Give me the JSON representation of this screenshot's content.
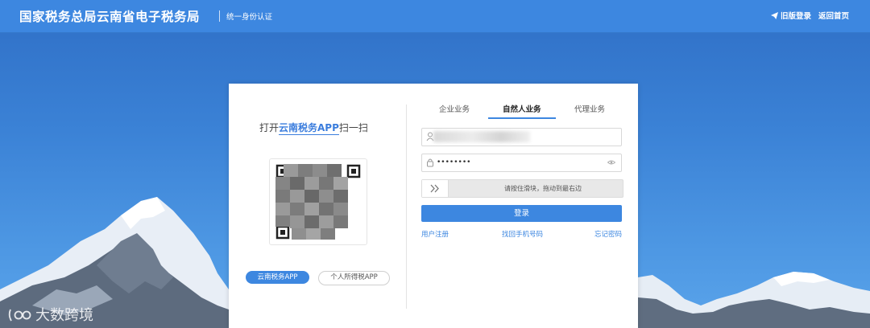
{
  "header": {
    "title": "国家税务总局云南省电子税务局",
    "subtitle": "统一身份认证",
    "old_login_label": "旧版登录",
    "home_label": "返回首页",
    "old_login_icon": "paper-plane-icon",
    "background_color": "#3d87e0"
  },
  "qr_panel": {
    "prompt_prefix": "打开",
    "prompt_highlight": "云南税务APP",
    "prompt_suffix": "扫一扫",
    "apps": [
      {
        "label": "云南税务APP",
        "active": true
      },
      {
        "label": "个人所得税APP",
        "active": false
      }
    ]
  },
  "login_panel": {
    "tabs": [
      {
        "label": "企业业务",
        "active": false
      },
      {
        "label": "自然人业务",
        "active": true
      },
      {
        "label": "代理业务",
        "active": false
      }
    ],
    "account_field": {
      "value": "",
      "icon": "user-icon"
    },
    "password_field": {
      "value": "••••••••",
      "icon": "lock-icon",
      "toggle_icon": "eye-icon"
    },
    "slider": {
      "text": "请按住滑块，拖动到最右边",
      "icon": "double-chevron-right-icon"
    },
    "login_button": "登录",
    "links": {
      "register": "用户注册",
      "recover_phone": "找回手机号码",
      "forgot_password": "忘记密码"
    }
  },
  "watermark": {
    "text": "大数跨境"
  },
  "colors": {
    "accent": "#3d87e0",
    "sky": "#4d97e3"
  }
}
